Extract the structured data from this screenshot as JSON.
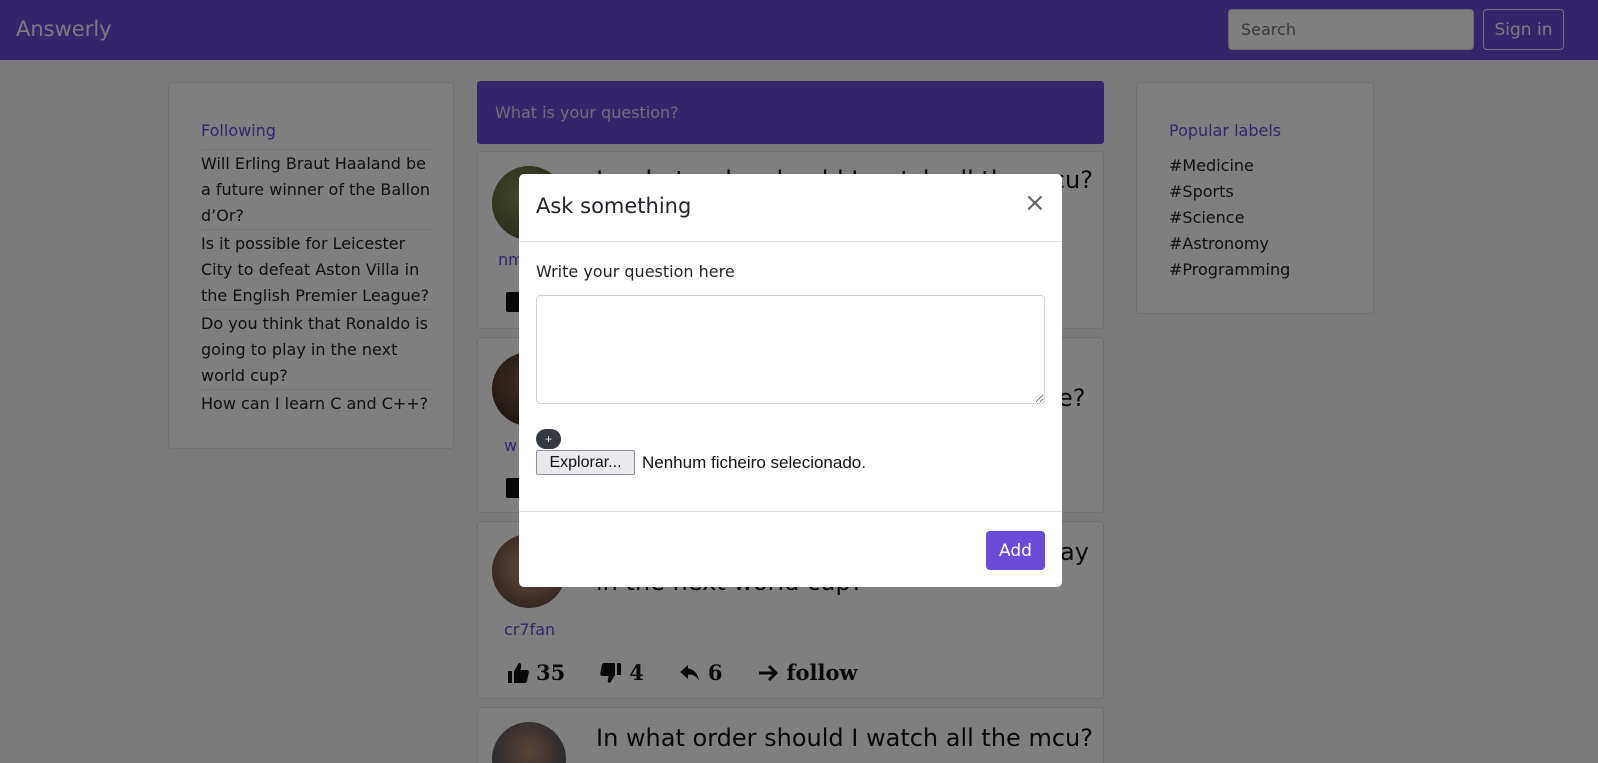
{
  "navbar": {
    "brand": "Answerly",
    "search_placeholder": "Search",
    "signin_label": "Sign in"
  },
  "following": {
    "title": "Following",
    "items": [
      "Will Erling Braut Haaland be a future winner of the Ballon d’Or?",
      "Is it possible for Leicester City to defeat Aston Villa in the English Premier League?",
      "Do you think that Ronaldo is going to play in the next world cup?",
      "How can I learn C and C++?"
    ]
  },
  "labels": {
    "title": "Popular labels",
    "items": [
      "#Medicine",
      "#Sports",
      "#Science",
      "#Astronomy",
      "#Programming"
    ]
  },
  "ask_bar": {
    "placeholder": "What is your question?"
  },
  "feed": {
    "posts": [
      {
        "username": "nm",
        "title": "In what order should I watch all the mcu?"
      },
      {
        "username": "w",
        "title": "e?"
      },
      {
        "username": "cr7fan",
        "title_line1": "ay",
        "title_line2": "in the next world cup?",
        "likes": "35",
        "dislikes": "4",
        "replies": "6",
        "follow_label": "follow"
      },
      {
        "title": "In what order should I watch all the mcu?"
      }
    ]
  },
  "modal": {
    "title": "Ask something",
    "close": "×",
    "field_label": "Write your question here",
    "question_value": "",
    "plus_label": "+",
    "file_button": "Explorar...",
    "file_status": "Nenhum ficheiro selecionado.",
    "add_label": "Add"
  },
  "colors": {
    "brand": "#6a4bd9",
    "overlay": "rgba(0,0,0,0.5)"
  }
}
